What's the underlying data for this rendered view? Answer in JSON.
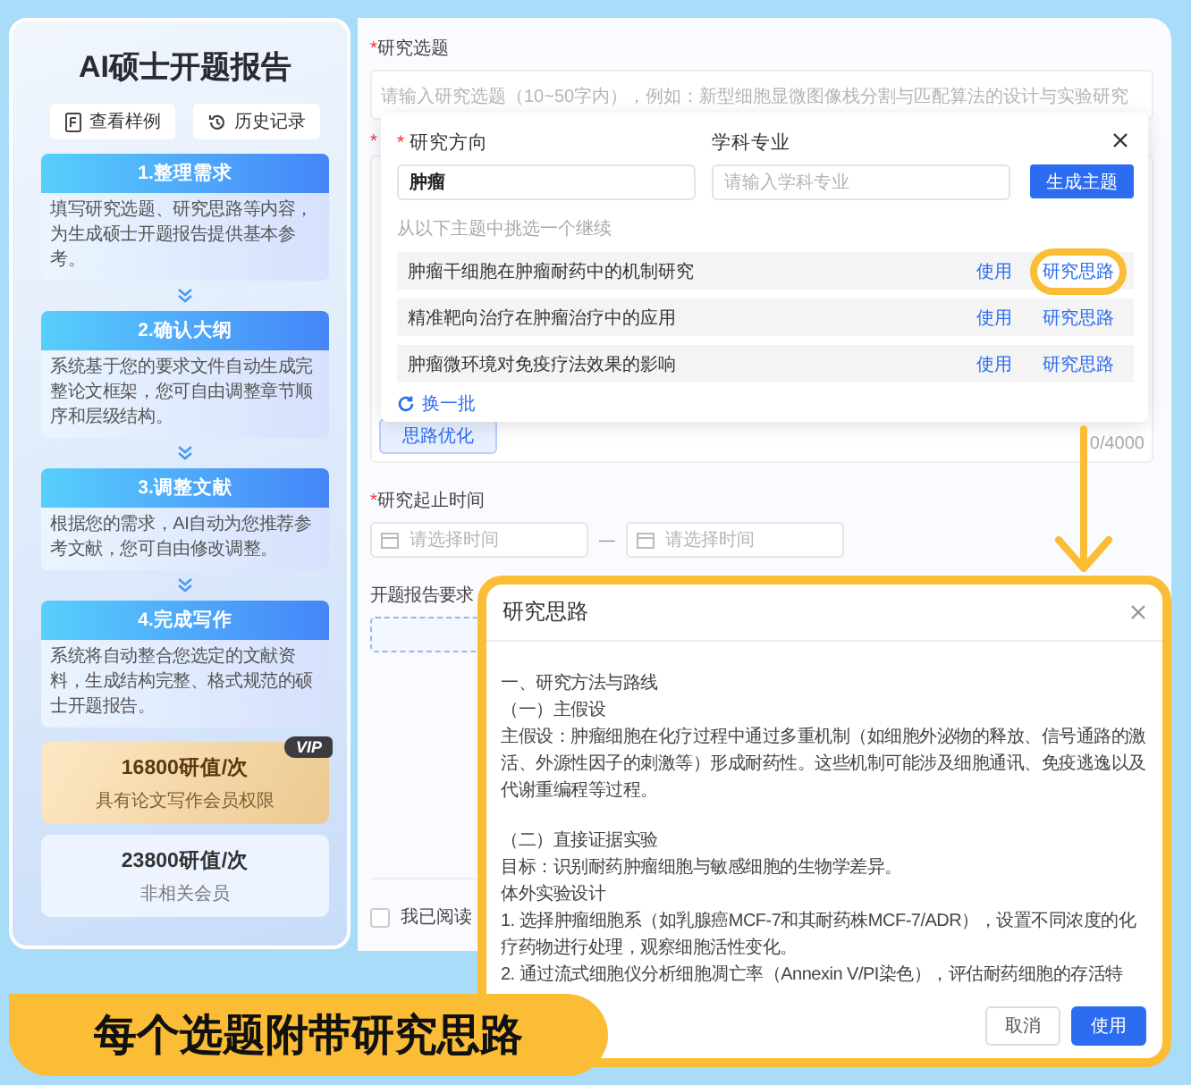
{
  "sidebar": {
    "title": "AI硕士开题报告",
    "buttons": [
      "查看样例",
      "历史记录"
    ],
    "steps": [
      {
        "title": "1.整理需求",
        "description": "填写研究选题、研究思路等内容，为生成硕士开题报告提供基本参考。"
      },
      {
        "title": "2.确认大纲",
        "description": "系统基于您的要求文件自动生成完整论文框架，您可自由调整章节顺序和层级结构。"
      },
      {
        "title": "3.调整文献",
        "description": "根据您的需求，AI自动为您推荐参考文献，您可自由修改调整。"
      },
      {
        "title": "4.完成写作",
        "description": "系统将自动整合您选定的文献资料，生成结构完整、格式规范的硕士开题报告。"
      }
    ],
    "plans": [
      {
        "kind": "member",
        "badge": "VIP",
        "price": "16800研值/次",
        "note": "具有论文写作会员权限"
      },
      {
        "kind": "standard",
        "price": "23800研值/次",
        "note": "非相关会员"
      }
    ]
  },
  "form": {
    "topic_mark": "*",
    "topic_label": "研究选题",
    "description_mark": "*",
    "period_mark": "*",
    "topic_placeholder": "请输入研究选题（10~50字内），例如：新型细胞显微图像栈分割与匹配算法的设计与实验研究",
    "optimize_button": "思路优化",
    "char_count": "0/4000",
    "period_label": "研究起止时间",
    "start_placeholder": "请选择时间",
    "separator": "—",
    "end_placeholder": "请选择时间",
    "requirements_label": "开题报告要求",
    "agreement": "我已阅读",
    "agreement_checked": false
  },
  "popover": {
    "direction_mark": "*",
    "direction_label": "研究方向",
    "direction_value": "肿瘤",
    "major_label": "学科专业",
    "major_placeholder": "请输入学科专业",
    "generate_button": "生成主题",
    "hint": "从以下主题中挑选一个继续",
    "topics": [
      {
        "title": "肿瘤干细胞在肿瘤耐药中的机制研究",
        "use": "使用",
        "ideas": "研究思路",
        "highlighted": true
      },
      {
        "title": "精准靶向治疗在肿瘤治疗中的应用",
        "use": "使用",
        "ideas": "研究思路",
        "highlighted": false
      },
      {
        "title": "肿瘤微环境对免疫疗法效果的影响",
        "use": "使用",
        "ideas": "研究思路",
        "highlighted": false
      }
    ],
    "refresh": "换一批"
  },
  "modal": {
    "title": "研究思路",
    "sections": [
      [
        "一、研究方法与路线",
        "（一）主假设",
        "主假设：肿瘤细胞在化疗过程中通过多重机制（如细胞外泌物的释放、信号通路的激活、外源性因子的刺激等）形成耐药性。这些机制可能涉及细胞通讯、免疫逃逸以及代谢重编程等过程。"
      ],
      [
        "（二）直接证据实验",
        "目标：识别耐药肿瘤细胞与敏感细胞的生物学差异。",
        "体外实验设计",
        "1. 选择肿瘤细胞系（如乳腺癌MCF-7和其耐药株MCF-7/ADR），设置不同浓度的化疗药物进行处理，观察细胞活性变化。",
        "2. 通过流式细胞仪分析细胞凋亡率（Annexin V/PI染色），评估耐药细胞的存活特"
      ]
    ],
    "buttons": [
      {
        "label": "取消",
        "primary": false
      },
      {
        "label": "使用",
        "primary": true
      }
    ]
  },
  "banner": "每个选题附带研究思路"
}
